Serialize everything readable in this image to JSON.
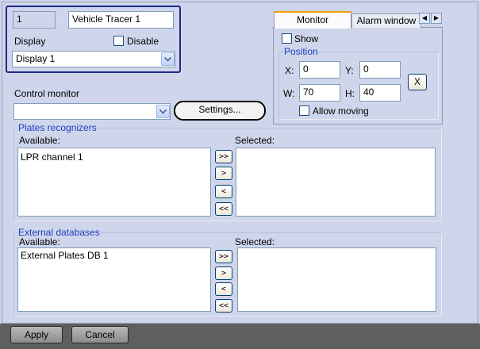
{
  "device": {
    "id": "1",
    "name": "Vehicle Tracer 1"
  },
  "display": {
    "label": "Display",
    "disable_label": "Disable",
    "selected": "Display 1"
  },
  "control_monitor": {
    "label": "Control monitor",
    "value": "",
    "settings_label": "Settings..."
  },
  "tabs": {
    "monitor": "Monitor",
    "alarm_window": "Alarm window"
  },
  "monitor_panel": {
    "show_label": "Show",
    "position_group": "Position",
    "x_label": "X:",
    "x_value": "0",
    "y_label": "Y:",
    "y_value": "0",
    "w_label": "W:",
    "w_value": "70",
    "h_label": "H:",
    "h_value": "40",
    "reset_label": "X",
    "allow_moving_label": "Allow moving"
  },
  "plates_recognizers": {
    "title": "Plates recognizers",
    "available_label": "Available:",
    "selected_label": "Selected:",
    "available": [
      "LPR channel 1"
    ],
    "selected": []
  },
  "external_databases": {
    "title": "External databases",
    "available_label": "Available:",
    "selected_label": "Selected:",
    "available": [
      "External Plates DB 1"
    ],
    "selected": []
  },
  "transfer": {
    "add_all": ">>",
    "add": ">",
    "remove": "<",
    "remove_all": "<<"
  },
  "footer": {
    "apply": "Apply",
    "cancel": "Cancel"
  },
  "colors": {
    "background": "#cfd6eb",
    "group_label": "#1c3dbf",
    "footer_bar": "#5f5f5f",
    "active_tab_accent": "#f0a000"
  }
}
